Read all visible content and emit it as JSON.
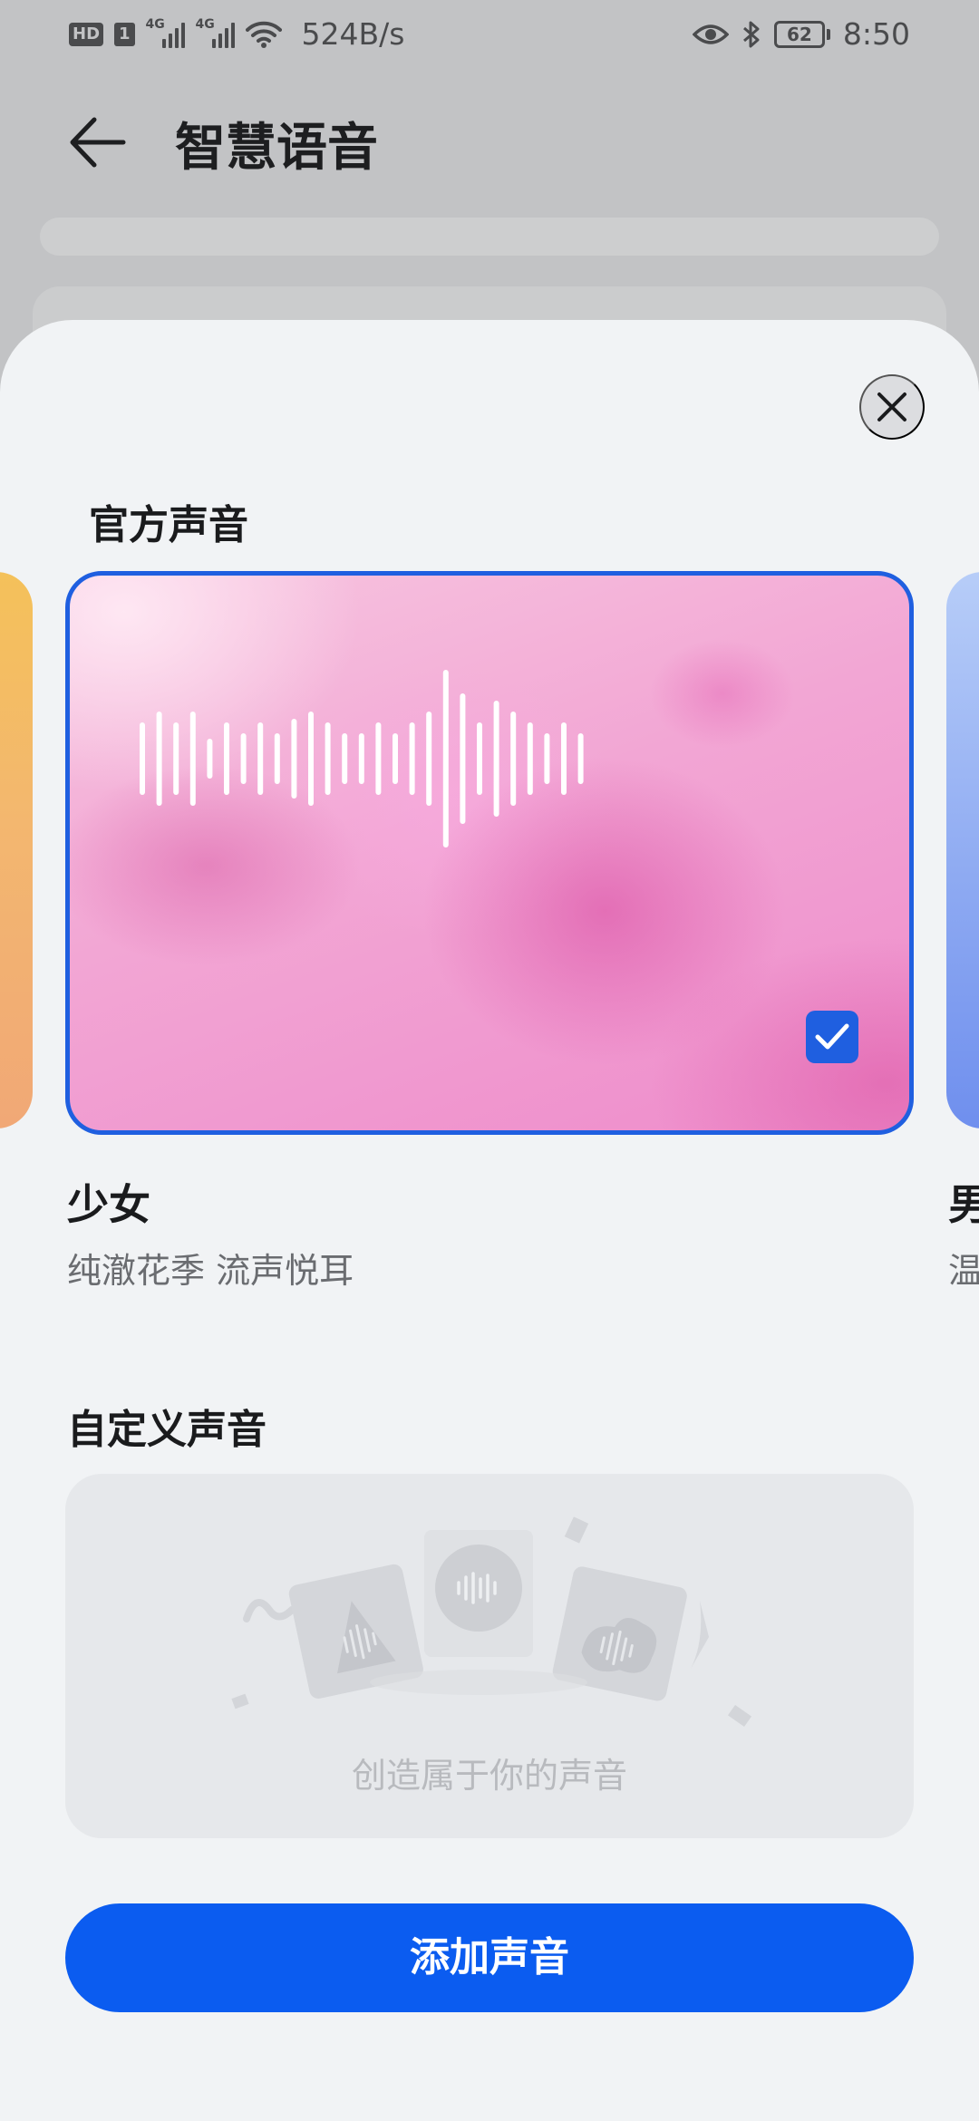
{
  "status_bar": {
    "hd": "HD",
    "sim": "1",
    "net1": "4G",
    "net2": "4G",
    "speed": "524B/s",
    "battery": "62",
    "time": "8:50"
  },
  "header": {
    "title": "智慧语音",
    "back_icon": "back-arrow-icon"
  },
  "sheet": {
    "official_section": {
      "title": "官方声音",
      "selected_voice": {
        "name": "少女",
        "description": "纯澈花季 流声悦耳",
        "selected": true
      },
      "next_voice_peek": {
        "name_partial": "男",
        "description_partial": "温"
      }
    },
    "custom_section": {
      "title": "自定义声音",
      "hint": "创造属于你的声音"
    },
    "add_button_label": "添加声音",
    "close_icon": "close-icon"
  },
  "colors": {
    "accent": "#0b5cf0",
    "card_border": "#1f5fe0",
    "sheet_bg": "#f1f3f5"
  }
}
